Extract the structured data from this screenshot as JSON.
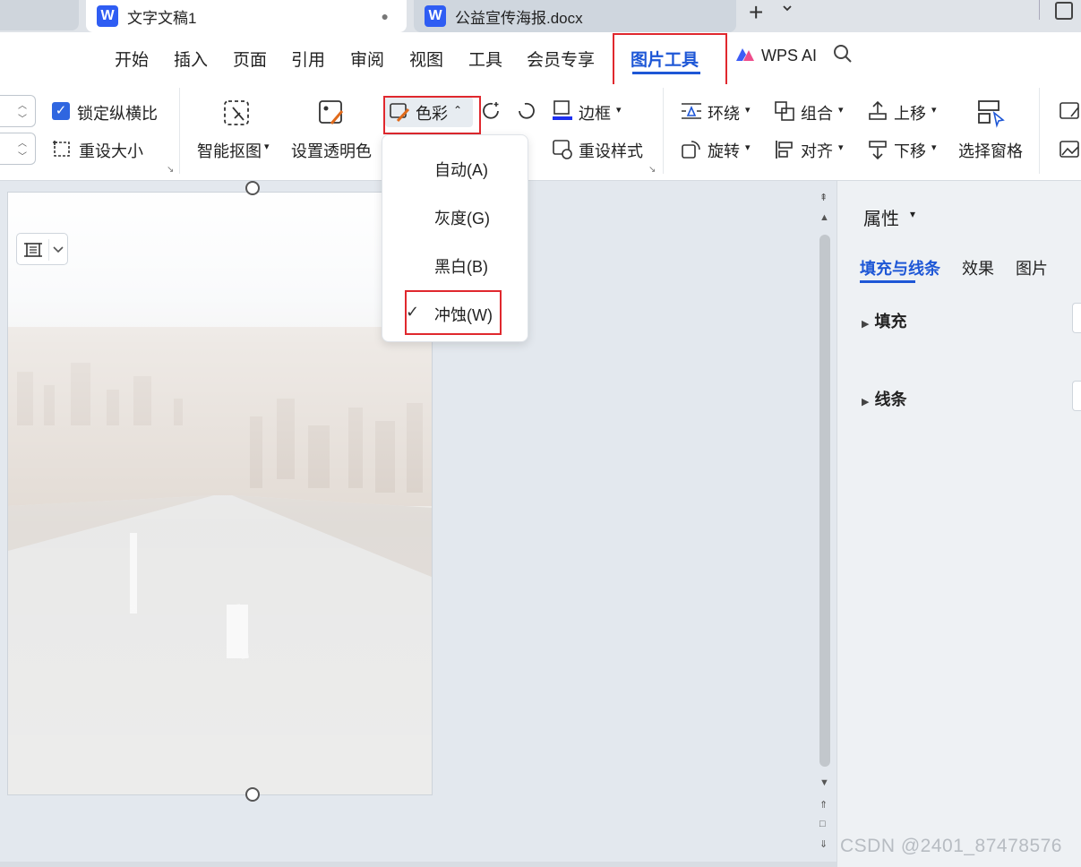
{
  "tabs": [
    {
      "title": "文字文稿1",
      "active": true,
      "unsaved_marker": "●"
    },
    {
      "title": "公益宣传海报.docx",
      "active": false
    }
  ],
  "tab_actions": {
    "new_tab": "+",
    "more": "⌄"
  },
  "menu": {
    "items": [
      "开始",
      "插入",
      "页面",
      "引用",
      "审阅",
      "视图",
      "工具",
      "会员专享"
    ],
    "active_item": "图片工具",
    "ai_label": "WPS AI"
  },
  "ribbon": {
    "lock_ratio_label": "锁定纵横比",
    "lock_ratio_checked": true,
    "reset_size_label": "重设大小",
    "smart_cutout_label": "智能抠图",
    "set_transparent_label": "设置透明色",
    "color_label": "色彩",
    "border_label": "边框",
    "reset_style_label": "重设样式",
    "wrap_label": "环绕",
    "group_label": "组合",
    "move_up_label": "上移",
    "rotate_label": "旋转",
    "align_label": "对齐",
    "move_down_label": "下移",
    "selection_pane_label": "选择窗格",
    "accent_color": "#1e57d6",
    "highlight_color": "#e0282e"
  },
  "color_menu": {
    "items": [
      {
        "label": "自动(A)",
        "checked": false
      },
      {
        "label": "灰度(G)",
        "checked": false
      },
      {
        "label": "黑白(B)",
        "checked": false
      },
      {
        "label": "冲蚀(W)",
        "checked": true
      }
    ],
    "check_glyph": "✓"
  },
  "panel": {
    "title": "属性",
    "tabs": [
      {
        "label": "填充与线条",
        "active": true
      },
      {
        "label": "效果",
        "active": false
      },
      {
        "label": "图片",
        "active": false
      }
    ],
    "sections": [
      "填充",
      "线条"
    ]
  },
  "watermark": "CSDN @2401_87478576"
}
